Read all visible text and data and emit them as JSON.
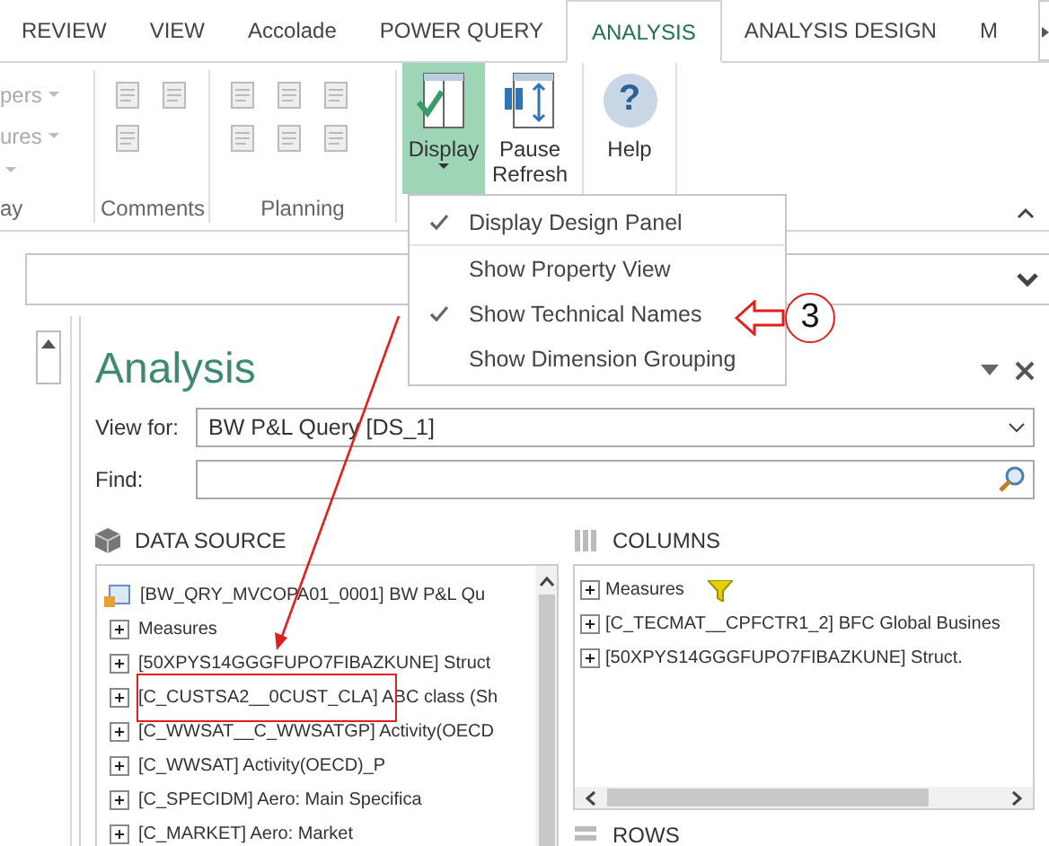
{
  "tabs": [
    {
      "label": "REVIEW",
      "selected": false
    },
    {
      "label": "VIEW",
      "selected": false
    },
    {
      "label": "Accolade",
      "selected": false
    },
    {
      "label": "POWER QUERY",
      "selected": false
    },
    {
      "label": "ANALYSIS",
      "selected": true
    },
    {
      "label": "ANALYSIS DESIGN",
      "selected": false
    },
    {
      "label": "M",
      "selected": false
    }
  ],
  "ribbon": {
    "partial_group": {
      "items": [
        "pers",
        "ures"
      ],
      "label": "ay"
    },
    "groups": [
      {
        "label": "Comments",
        "kind": "comments"
      },
      {
        "label": "Planning",
        "kind": "planning"
      }
    ],
    "large_buttons": [
      {
        "label": "Display",
        "kind": "display",
        "pressed": true
      },
      {
        "label": "Pause Refresh",
        "kind": "pause",
        "pressed": false
      },
      {
        "label": "Help",
        "kind": "help",
        "pressed": false,
        "glyph": "?"
      }
    ]
  },
  "display_menu": [
    {
      "label": "Display Design Panel",
      "checked": true
    },
    {
      "label": "Show Property View",
      "checked": false
    },
    {
      "label": "Show Technical Names",
      "checked": true
    },
    {
      "label": "Show Dimension Grouping",
      "checked": false
    }
  ],
  "panel": {
    "title": "Analysis",
    "view_for": {
      "label": "View for:",
      "value": "BW P&L Query [DS_1]"
    },
    "find": {
      "label": "Find:"
    },
    "data_source": {
      "title": "DATA SOURCE",
      "root": "[BW_QRY_MVCOPA01_0001] BW P&L Qu",
      "items": [
        "Measures",
        "[50XPYS14GGGFUPO7FIBAZKUNE] Struct",
        "[C_CUSTSA2__0CUST_CLA] ABC class (Sh",
        "[C_WWSAT__C_WWSATGP] Activity(OECD",
        "[C_WWSAT] Activity(OECD)_P",
        "[C_SPECIDM] Aero: Main Specifica",
        "[C_MARKET] Aero: Market"
      ]
    },
    "columns": {
      "title": "COLUMNS",
      "items": [
        {
          "label": "Measures",
          "filtered": true
        },
        {
          "label": "[C_TECMAT__CPFCTR1_2] BFC Global Busines",
          "filtered": false
        },
        {
          "label": "[50XPYS14GGGFUPO7FIBAZKUNE] Struct.",
          "filtered": false
        }
      ]
    },
    "rows": {
      "title": "ROWS"
    }
  },
  "annotation": {
    "step": "3"
  }
}
